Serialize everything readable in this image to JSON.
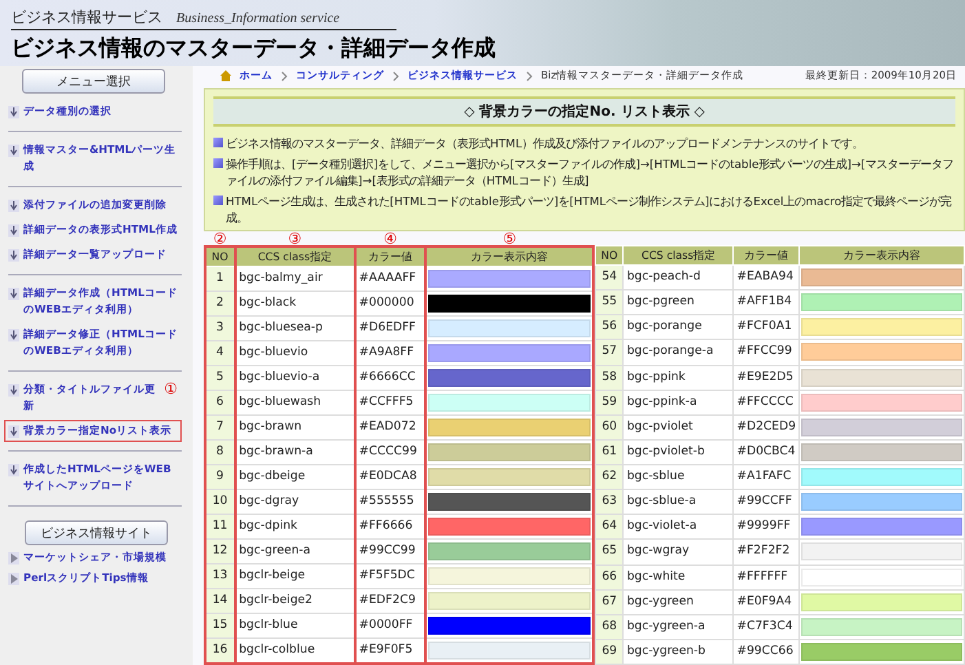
{
  "header": {
    "site_name": "ビジネス情報サービス",
    "site_name_en": "Business_Information service",
    "title": "ビジネス情報のマスターデータ・詳細データ作成"
  },
  "sidebar": {
    "menu_button": "メニュー選択",
    "groups": [
      [
        {
          "label": "データ種別の選択",
          "selected": false
        }
      ],
      [
        {
          "label": "情報マスター&HTMLパーツ生成",
          "selected": false
        }
      ],
      [
        {
          "label": "添付ファイルの追加変更削除",
          "selected": false
        },
        {
          "label": "詳細データの表形式HTML作成",
          "selected": false
        },
        {
          "label": "詳細データ一覧アップロード",
          "selected": false
        }
      ],
      [
        {
          "label": "詳細データ作成（HTMLコードのWEBエディタ利用）",
          "selected": false
        },
        {
          "label": "詳細データ修正（HTMLコードのWEBエディタ利用）",
          "selected": false
        }
      ],
      [
        {
          "label": "分類・タイトルファイル更新",
          "selected": false,
          "annotation": "①"
        },
        {
          "label": "背景カラー指定Noリスト表示",
          "selected": true
        }
      ],
      [
        {
          "label": "作成したHTMLページをWEBサイトへアップロード",
          "selected": false
        }
      ]
    ],
    "site_button": "ビジネス情報サイト",
    "site_links": [
      "マーケットシェア・市場規模",
      "PerlスクリプトTips情報"
    ]
  },
  "breadcrumb": {
    "items": [
      "ホーム",
      "コンサルティング",
      "ビジネス情報サービス"
    ],
    "current": "Biz情報マスターデータ・詳細データ作成",
    "updated": "最終更新日：2009年10月20日"
  },
  "panel": {
    "heading": "◇ 背景カラーの指定No. リスト表示 ◇",
    "paragraphs": [
      "ビジネス情報のマスターデータ、詳細データ（表形式HTML）作成及び添付ファイルのアップロードメンテナンスのサイトです。",
      "操作手順は、[データ種別選択]をして、メニュー選択から[マスターファイルの作成]→[HTMLコードのtable形式パーツの生成]→[マスターデータファイルの添付ファイル編集]→[表形式の詳細データ（HTMLコード）生成]",
      "HTMLページ生成は、生成された[HTMLコードのtable形式パーツ]を[HTMLページ制作システム]におけるExcel上のmacro指定で最終ページが完成。"
    ]
  },
  "tables": [
    {
      "columns": [
        {
          "label": "NO",
          "annotation": "②",
          "outlined": true
        },
        {
          "label": "CCS class指定",
          "annotation": "③",
          "outlined": true
        },
        {
          "label": "カラー値",
          "annotation": "④",
          "outlined": true
        },
        {
          "label": "カラー表示内容",
          "annotation": "⑤",
          "outlined": true
        }
      ],
      "rows": [
        {
          "no": "1",
          "css_class": "bgc-balmy_air",
          "value": "#AAAAFF",
          "color": "#aaaaff"
        },
        {
          "no": "2",
          "css_class": "bgc-black",
          "value": "#000000",
          "color": "#000000"
        },
        {
          "no": "3",
          "css_class": "bgc-bluesea-p",
          "value": "#D6EDFF",
          "color": "#d6edff"
        },
        {
          "no": "4",
          "css_class": "bgc-bluevio",
          "value": "#A9A8FF",
          "color": "#a9a8ff"
        },
        {
          "no": "5",
          "css_class": "bgc-bluevio-a",
          "value": "#6666CC",
          "color": "#6666cc"
        },
        {
          "no": "6",
          "css_class": "bgc-bluewash",
          "value": "#CCFFF5",
          "color": "#ccfff5"
        },
        {
          "no": "7",
          "css_class": "bgc-brawn",
          "value": "#EAD072",
          "color": "#ead072"
        },
        {
          "no": "8",
          "css_class": "bgc-brawn-a",
          "value": "#CCCC99",
          "color": "#cccc99"
        },
        {
          "no": "9",
          "css_class": "bgc-dbeige",
          "value": "#E0DCA8",
          "color": "#e0dca8"
        },
        {
          "no": "10",
          "css_class": "bgc-dgray",
          "value": "#555555",
          "color": "#555555"
        },
        {
          "no": "11",
          "css_class": "bgc-dpink",
          "value": "#FF6666",
          "color": "#ff6666"
        },
        {
          "no": "12",
          "css_class": "bgc-green-a",
          "value": "#99CC99",
          "color": "#99cc99"
        },
        {
          "no": "13",
          "css_class": "bgclr-beige",
          "value": "#F5F5DC",
          "color": "#f5f5dc"
        },
        {
          "no": "14",
          "css_class": "bgclr-beige2",
          "value": "#EDF2C9",
          "color": "#edf2c9"
        },
        {
          "no": "15",
          "css_class": "bgclr-blue",
          "value": "#0000FF",
          "color": "#0000ff"
        },
        {
          "no": "16",
          "css_class": "bgclr-colblue",
          "value": "#E9F0F5",
          "color": "#e9f0f5"
        }
      ]
    },
    {
      "columns": [
        {
          "label": "NO",
          "outlined": false
        },
        {
          "label": "CCS class指定",
          "outlined": false
        },
        {
          "label": "カラー値",
          "outlined": false
        },
        {
          "label": "カラー表示内容",
          "outlined": false
        }
      ],
      "rows": [
        {
          "no": "54",
          "css_class": "bgc-peach-d",
          "value": "#EABA94",
          "color": "#eaba94"
        },
        {
          "no": "55",
          "css_class": "bgc-pgreen",
          "value": "#AFF1B4",
          "color": "#aff1b4"
        },
        {
          "no": "56",
          "css_class": "bgc-porange",
          "value": "#FCF0A1",
          "color": "#fcf0a1"
        },
        {
          "no": "57",
          "css_class": "bgc-porange-a",
          "value": "#FFCC99",
          "color": "#ffcc99"
        },
        {
          "no": "58",
          "css_class": "bgc-ppink",
          "value": "#E9E2D5",
          "color": "#e9e2d5"
        },
        {
          "no": "59",
          "css_class": "bgc-ppink-a",
          "value": "#FFCCCC",
          "color": "#ffcccc"
        },
        {
          "no": "60",
          "css_class": "bgc-pviolet",
          "value": "#D2CED9",
          "color": "#d2ced9"
        },
        {
          "no": "61",
          "css_class": "bgc-pviolet-b",
          "value": "#D0CBC4",
          "color": "#d0cbc4"
        },
        {
          "no": "62",
          "css_class": "bgc-sblue",
          "value": "#A1FAFC",
          "color": "#a1fafc"
        },
        {
          "no": "63",
          "css_class": "bgc-sblue-a",
          "value": "#99CCFF",
          "color": "#99ccff"
        },
        {
          "no": "64",
          "css_class": "bgc-violet-a",
          "value": "#9999FF",
          "color": "#9999ff"
        },
        {
          "no": "65",
          "css_class": "bgc-wgray",
          "value": "#F2F2F2",
          "color": "#f2f2f2"
        },
        {
          "no": "66",
          "css_class": "bgc-white",
          "value": "#FFFFFF",
          "color": "#ffffff"
        },
        {
          "no": "67",
          "css_class": "bgc-ygreen",
          "value": "#E0F9A4",
          "color": "#e0f9a4"
        },
        {
          "no": "68",
          "css_class": "bgc-ygreen-a",
          "value": "#C7F3C4",
          "color": "#c7f3c4"
        },
        {
          "no": "69",
          "css_class": "bgc-ygreen-b",
          "value": "#99CC66",
          "color": "#99cc66"
        }
      ]
    }
  ]
}
